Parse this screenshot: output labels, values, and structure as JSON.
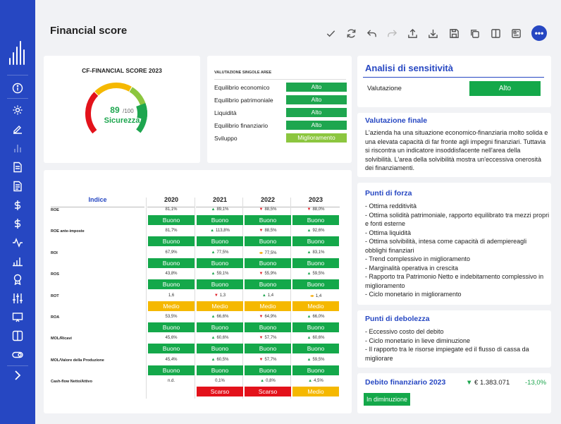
{
  "header": {
    "title": "Financial score"
  },
  "toolbar": {
    "icons": [
      "check-icon",
      "refresh-icon",
      "undo-icon",
      "redo-icon",
      "upload-icon",
      "download-icon",
      "save-icon",
      "copy-icon",
      "split-view-icon",
      "dashboard-icon",
      "more-icon"
    ],
    "more_label": "•••"
  },
  "sidebar": {
    "icons": [
      "logo-icon",
      "info-icon",
      "settings-icon",
      "edit-icon",
      "bar-chart-icon",
      "document-icon",
      "document-alt-icon",
      "dollar-icon",
      "dollar-alt-icon",
      "activity-icon",
      "stats-icon",
      "award-icon",
      "sliders-icon",
      "presentation-icon",
      "columns-icon",
      "toggle-icon",
      "chevron-right-icon"
    ]
  },
  "gauge": {
    "title": "CF-FINANCIAL SCORE 2023",
    "score": "89",
    "max": "/100",
    "label": "Sicurezza",
    "value_fraction": 0.89
  },
  "aree": {
    "title": "VALUTAZIONE SINGOLE AREE",
    "rows": [
      {
        "label": "Equilibrio economico",
        "badge": "Alto",
        "color": "#1ea64f"
      },
      {
        "label": "Equilibrio patrimoniale",
        "badge": "Alto",
        "color": "#1ea64f"
      },
      {
        "label": "Liquidità",
        "badge": "Alto",
        "color": "#1ea64f"
      },
      {
        "label": "Equilibrio  finanziario",
        "badge": "Alto",
        "color": "#1ea64f"
      },
      {
        "label": "Sviluppo",
        "badge": "Miglioramento",
        "color": "#8cc63f"
      }
    ]
  },
  "table": {
    "headers": [
      "Indice",
      "2020",
      "2021",
      "2022",
      "2023"
    ],
    "rows": [
      {
        "label": "ROE",
        "values": [
          [
            "",
            "81,1%"
          ],
          [
            "up",
            "89,1%"
          ],
          [
            "down",
            "88,5%"
          ],
          [
            "down",
            "88,0%"
          ]
        ],
        "badges": [
          "Buono",
          "Buono",
          "Buono",
          "Buono"
        ]
      },
      {
        "label": "ROE ante-imposte",
        "values": [
          [
            "",
            "81,7%"
          ],
          [
            "up",
            "113,8%"
          ],
          [
            "down",
            "88,5%"
          ],
          [
            "up",
            "92,6%"
          ]
        ],
        "badges": [
          "Buono",
          "Buono",
          "Buono",
          "Buono"
        ]
      },
      {
        "label": "ROI",
        "values": [
          [
            "",
            "67,9%"
          ],
          [
            "up",
            "77,5%"
          ],
          [
            "side",
            "77,5%"
          ],
          [
            "up",
            "83,1%"
          ]
        ],
        "badges": [
          "Buono",
          "Buono",
          "Buono",
          "Buono"
        ]
      },
      {
        "label": "ROS",
        "values": [
          [
            "",
            "43,8%"
          ],
          [
            "up",
            "59,1%"
          ],
          [
            "down",
            "55,9%"
          ],
          [
            "up",
            "59,5%"
          ]
        ],
        "badges": [
          "Buono",
          "Buono",
          "Buono",
          "Buono"
        ]
      },
      {
        "label": "ROT",
        "values": [
          [
            "",
            "1,6"
          ],
          [
            "down",
            "1,3"
          ],
          [
            "up",
            "1,4"
          ],
          [
            "side",
            "1,4"
          ]
        ],
        "badges": [
          "Medio",
          "Medio",
          "Medio",
          "Medio"
        ]
      },
      {
        "label": "ROA",
        "values": [
          [
            "",
            "53,5%"
          ],
          [
            "up",
            "66,6%"
          ],
          [
            "down",
            "64,9%"
          ],
          [
            "up",
            "66,0%"
          ]
        ],
        "badges": [
          "Buono",
          "Buono",
          "Buono",
          "Buono"
        ]
      },
      {
        "label": "MOL/Ricavi",
        "values": [
          [
            "",
            "45,6%"
          ],
          [
            "up",
            "60,6%"
          ],
          [
            "down",
            "57,7%"
          ],
          [
            "up",
            "60,6%"
          ]
        ],
        "badges": [
          "Buono",
          "Buono",
          "Buono",
          "Buono"
        ]
      },
      {
        "label": "MOL/Valore della Produzione",
        "values": [
          [
            "",
            "45,4%"
          ],
          [
            "up",
            "60,5%"
          ],
          [
            "down",
            "57,7%"
          ],
          [
            "up",
            "59,5%"
          ]
        ],
        "badges": [
          "Buono",
          "Buono",
          "Buono",
          "Buono"
        ]
      },
      {
        "label": "Cash-flow Netto/Attivo",
        "values": [
          [
            "",
            "n.d."
          ],
          [
            "",
            "0,1%"
          ],
          [
            "up",
            "0,8%"
          ],
          [
            "up",
            "4,5%"
          ]
        ],
        "badges": [
          "",
          "Scarso",
          "Scarso",
          "Medio"
        ]
      }
    ],
    "badge_colors": {
      "Buono": "#14a84a",
      "Medio": "#f5b800",
      "Scarso": "#e3121b"
    }
  },
  "sensitivity": {
    "title": "Analisi di sensitività",
    "label": "Valutazione",
    "badge": "Alto"
  },
  "valutazione_finale": {
    "title": "Valutazione finale",
    "text": "L'azienda ha una situazione economico-finanziaria molto solida e una elevata capacità di far fronte agli impegni finanziari. Tuttavia si riscontra un indicatore insoddisfacente nell'area della solvibilità. L'area della solvibilità mostra un'eccessiva onerosità dei finanziamenti."
  },
  "punti_forza": {
    "title": "Punti di forza",
    "items": [
      "- Ottima redditività",
      "- Ottima solidità patrimoniale, rapporto equilibrato tra mezzi propri e fonti esterne",
      "- Ottima liquidità",
      "- Ottima solvibilità, intesa come capacità di adempiereagli obblighi finanziari",
      "- Trend complessivo in miglioramento",
      "- Marginalità operativa in crescita",
      "- Rapporto tra Patrimonio Netto e indebitamento complessivo in miglioramento",
      "- Ciclo monetario in miglioramento"
    ]
  },
  "punti_debolezza": {
    "title": "Punti di debolezza",
    "items": [
      "- Eccessivo costo del debito",
      "- Ciclo monetario in lieve diminuzione",
      "- Il rapporto tra le risorse impiegate ed il flusso di cassa da migliorare"
    ]
  },
  "debito": {
    "title": "Debito finanziario 2023",
    "arrow": "▼",
    "value": "€ 1.383.071",
    "delta": "-13,0%",
    "badge": "In diminuzione"
  },
  "colors": {
    "accent": "#2647c2",
    "green": "#1ea64f",
    "red": "#e3121b",
    "yellow": "#f5b800"
  }
}
